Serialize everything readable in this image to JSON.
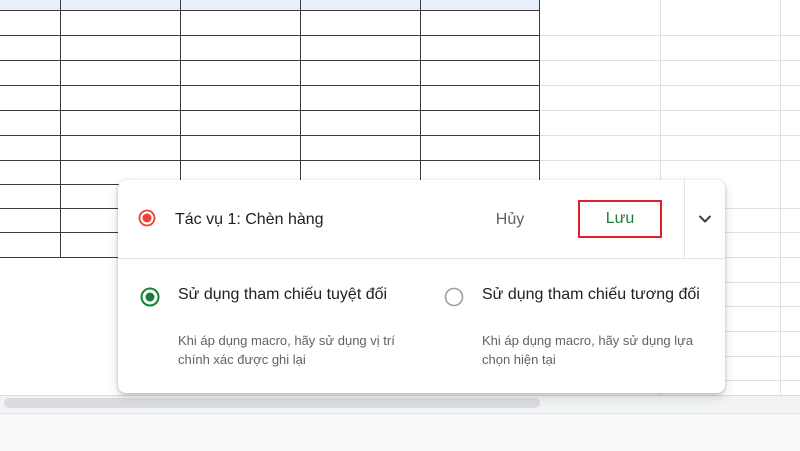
{
  "macro_panel": {
    "title": "Tác vụ 1: Chèn hàng",
    "cancel_label": "Hủy",
    "save_label": "Lưu",
    "options": [
      {
        "title": "Sử dụng tham chiếu tuyệt đối",
        "description": "Khi áp dụng macro, hãy sử dụng vị trí chính xác được ghi lại",
        "selected": true
      },
      {
        "title": "Sử dụng tham chiếu tương đối",
        "description": "Khi áp dụng macro, hãy sử dụng lựa chọn hiện tại",
        "selected": false
      }
    ]
  },
  "colors": {
    "recording_red": "#ea4335",
    "save_green": "#188038",
    "highlight_border": "#e0202a",
    "radio_selected": "#188038"
  },
  "icons": {
    "record": "record-icon",
    "expand": "chevron-down-icon"
  }
}
